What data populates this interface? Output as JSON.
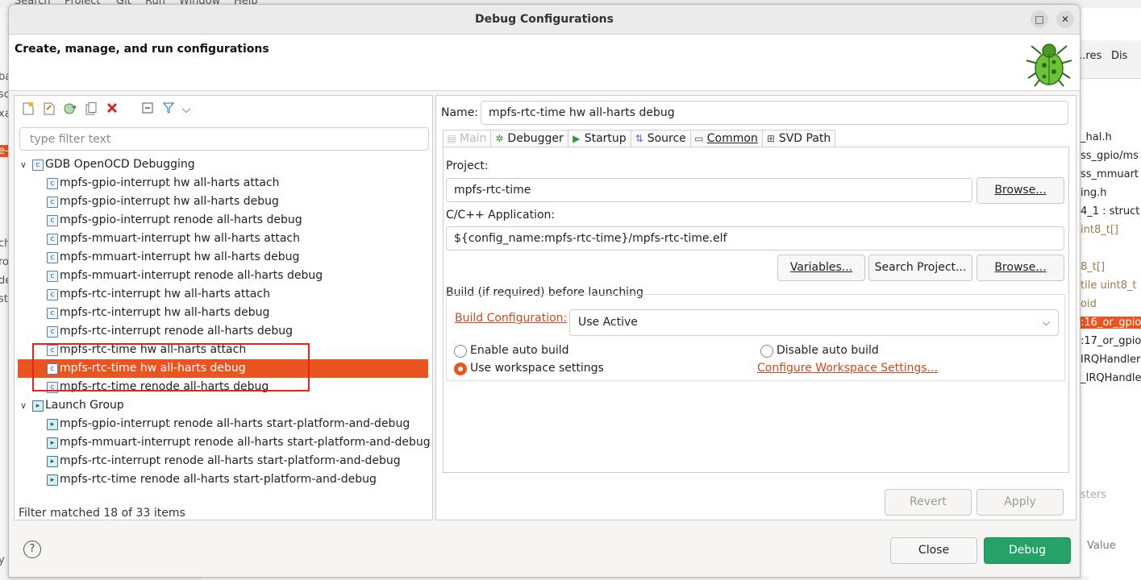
{
  "background": {
    "menu": [
      "Search",
      "Project",
      "Git",
      "Run",
      "Window",
      "Help"
    ],
    "right_tabs": [
      "...res",
      "Dis"
    ],
    "right_rows": [
      {
        "text": "_hal.h",
        "style": ""
      },
      {
        "text": "ss_gpio/ms",
        "style": ""
      },
      {
        "text": "ss_mmuart",
        "style": ""
      },
      {
        "text": "ing.h",
        "style": ""
      },
      {
        "text": "4_1 : struct",
        "style": "mixed"
      },
      {
        "text": "int8_t[]",
        "style": "muted"
      },
      {
        "text": "8_t[]",
        "style": "muted"
      },
      {
        "text": "tile uint8_t",
        "style": "muted"
      },
      {
        "text": "oid",
        "style": "muted"
      },
      {
        "text": ":16_or_gpio",
        "style": "hl"
      },
      {
        "text": ":17_or_gpio",
        "style": ""
      },
      {
        "text": "IRQHandler(v",
        "style": ""
      },
      {
        "text": "_IRQHandle",
        "style": ""
      }
    ],
    "right_bottom_tab": "sters",
    "right_bottom_col": "Value",
    "left_fragments": [
      "ba",
      "so",
      "xa",
      "e-",
      "ch",
      "rou",
      "de",
      "st",
      "y a"
    ]
  },
  "dialog": {
    "title": "Debug Configurations",
    "heading": "Create, manage, and run configurations",
    "window_buttons": {
      "maximize": "□",
      "close": "✕"
    },
    "left": {
      "filter_placeholder": "type filter text",
      "status": "Filter matched 18 of 33 items",
      "tree": {
        "group1": {
          "label": "GDB OpenOCD Debugging",
          "items": [
            "mpfs-gpio-interrupt hw all-harts attach",
            "mpfs-gpio-interrupt hw all-harts debug",
            "mpfs-gpio-interrupt renode all-harts debug",
            "mpfs-mmuart-interrupt hw all-harts attach",
            "mpfs-mmuart-interrupt hw all-harts debug",
            "mpfs-mmuart-interrupt renode all-harts debug",
            "mpfs-rtc-interrupt hw all-harts attach",
            "mpfs-rtc-interrupt hw all-harts debug",
            "mpfs-rtc-interrupt renode all-harts debug",
            "mpfs-rtc-time hw all-harts attach",
            "mpfs-rtc-time hw all-harts debug",
            "mpfs-rtc-time renode all-harts debug"
          ]
        },
        "group2": {
          "label": "Launch Group",
          "items": [
            "mpfs-gpio-interrupt renode all-harts start-platform-and-debug",
            "mpfs-mmuart-interrupt renode all-harts start-platform-and-debug",
            "mpfs-rtc-interrupt renode all-harts start-platform-and-debug",
            "mpfs-rtc-time renode all-harts start-platform-and-debug"
          ]
        },
        "selected": "mpfs-rtc-time hw all-harts debug"
      }
    },
    "right": {
      "name_label": "Name:",
      "name_value": "mpfs-rtc-time hw all-harts debug",
      "tabs": [
        {
          "label": "Main",
          "icon": "main-tab-icon",
          "active": true
        },
        {
          "label": "Debugger",
          "icon": "debugger-tab-icon"
        },
        {
          "label": "Startup",
          "icon": "startup-tab-icon"
        },
        {
          "label": "Source",
          "icon": "source-tab-icon"
        },
        {
          "label": "Common",
          "icon": "common-tab-icon"
        },
        {
          "label": "SVD Path",
          "icon": "svd-tab-icon"
        }
      ],
      "project_label": "Project:",
      "project_value": "mpfs-rtc-time",
      "browse1": "Browse...",
      "app_label": "C/C++ Application:",
      "app_value": "${config_name:mpfs-rtc-time}/mpfs-rtc-time.elf",
      "variables": "Variables...",
      "search_project": "Search Project...",
      "browse2": "Browse...",
      "build_group": "Build (if required) before launching",
      "build_config_link": "Build Configuration:",
      "build_config_value": "Use Active",
      "enable_auto": "Enable auto build",
      "disable_auto": "Disable auto build",
      "use_workspace": "Use workspace settings",
      "configure_workspace": "Configure Workspace Settings...",
      "revert": "Revert",
      "apply": "Apply"
    },
    "footer": {
      "help": "?",
      "close": "Close",
      "debug": "Debug"
    },
    "colors": {
      "accent": "#e95420",
      "debug_button": "#26a269",
      "link": "#c64b1d"
    }
  }
}
